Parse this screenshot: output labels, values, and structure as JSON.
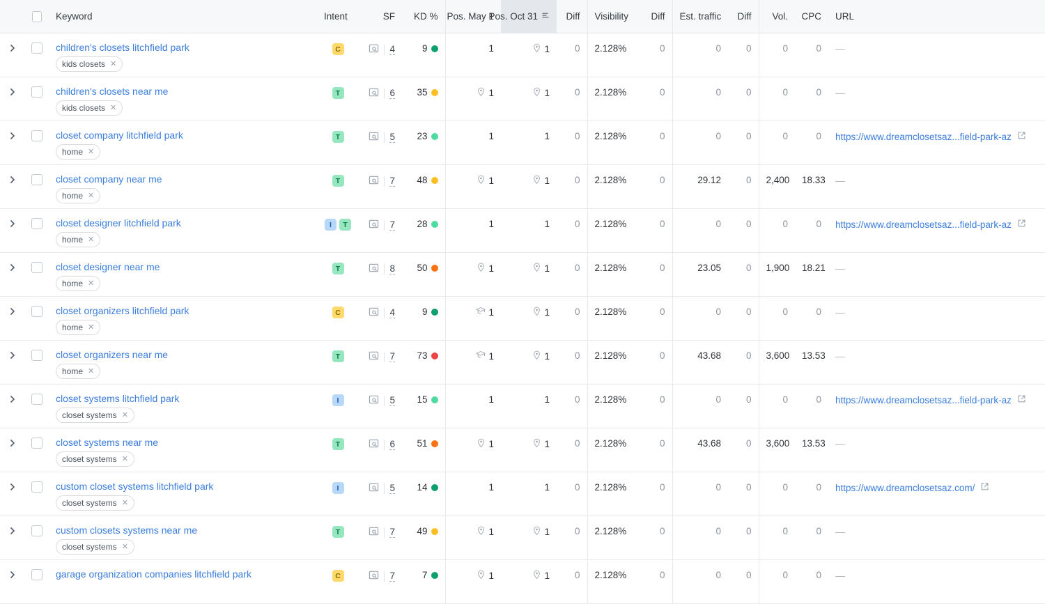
{
  "table": {
    "columns": [
      {
        "key": "expand",
        "label": "",
        "align": "left"
      },
      {
        "key": "check",
        "label": "",
        "align": "left"
      },
      {
        "key": "keyword",
        "label": "Keyword",
        "align": "left"
      },
      {
        "key": "intent",
        "label": "Intent",
        "align": "left"
      },
      {
        "key": "sf",
        "label": "SF",
        "align": "right"
      },
      {
        "key": "kd",
        "label": "KD %",
        "align": "right"
      },
      {
        "key": "pos_may",
        "label": "Pos. May 1",
        "align": "right"
      },
      {
        "key": "pos_oct",
        "label": "Pos. Oct 31",
        "align": "right",
        "sorted": true,
        "sort_icon": "sort-icon"
      },
      {
        "key": "diff1",
        "label": "Diff",
        "align": "right"
      },
      {
        "key": "vis",
        "label": "Visibility",
        "align": "left"
      },
      {
        "key": "diff2",
        "label": "Diff",
        "align": "right"
      },
      {
        "key": "traffic",
        "label": "Est. traffic",
        "align": "left"
      },
      {
        "key": "diff3",
        "label": "Diff",
        "align": "right"
      },
      {
        "key": "vol",
        "label": "Vol.",
        "align": "right"
      },
      {
        "key": "cpc",
        "label": "CPC",
        "align": "right"
      },
      {
        "key": "url",
        "label": "URL",
        "align": "left"
      }
    ],
    "header_checkbox": {
      "name": "select-all-checkbox",
      "checked": false
    },
    "kd_colors": {
      "easy": "#0e9f6e",
      "light_green": "#4ddba0",
      "yellow": "#fbbf24",
      "orange": "#f97316",
      "red": "#ef4444"
    },
    "rows": [
      {
        "keyword": "children's closets litchfield park",
        "tag": "kids closets",
        "intent": [
          "C"
        ],
        "sf": "4",
        "kd": "9",
        "kd_color": "easy",
        "pos_may": "1",
        "pos_may_icon": "",
        "pos_oct": "1",
        "pos_oct_icon": "map-pin-icon",
        "diff1": "0",
        "vis": "2.128%",
        "diff2": "0",
        "traffic": "0",
        "diff3": "0",
        "vol": "0",
        "cpc": "0",
        "url": ""
      },
      {
        "keyword": "children's closets near me",
        "tag": "kids closets",
        "intent": [
          "T"
        ],
        "sf": "6",
        "kd": "35",
        "kd_color": "yellow",
        "pos_may": "1",
        "pos_may_icon": "map-pin-icon",
        "pos_oct": "1",
        "pos_oct_icon": "map-pin-icon",
        "diff1": "0",
        "vis": "2.128%",
        "diff2": "0",
        "traffic": "0",
        "diff3": "0",
        "vol": "0",
        "cpc": "0",
        "url": ""
      },
      {
        "keyword": "closet company litchfield park",
        "tag": "home",
        "intent": [
          "T"
        ],
        "sf": "5",
        "kd": "23",
        "kd_color": "light_green",
        "pos_may": "1",
        "pos_may_icon": "",
        "pos_oct": "1",
        "pos_oct_icon": "",
        "diff1": "0",
        "vis": "2.128%",
        "diff2": "0",
        "traffic": "0",
        "diff3": "0",
        "vol": "0",
        "cpc": "0",
        "url": "https://www.dreamclosetsaz...field-park-az"
      },
      {
        "keyword": "closet company near me",
        "tag": "home",
        "intent": [
          "T"
        ],
        "sf": "7",
        "kd": "48",
        "kd_color": "yellow",
        "pos_may": "1",
        "pos_may_icon": "map-pin-icon",
        "pos_oct": "1",
        "pos_oct_icon": "map-pin-icon",
        "diff1": "0",
        "vis": "2.128%",
        "diff2": "0",
        "traffic": "29.12",
        "diff3": "0",
        "vol": "2,400",
        "cpc": "18.33",
        "url": ""
      },
      {
        "keyword": "closet designer litchfield park",
        "tag": "home",
        "intent": [
          "I",
          "T"
        ],
        "sf": "7",
        "kd": "28",
        "kd_color": "light_green",
        "pos_may": "1",
        "pos_may_icon": "",
        "pos_oct": "1",
        "pos_oct_icon": "",
        "diff1": "0",
        "vis": "2.128%",
        "diff2": "0",
        "traffic": "0",
        "diff3": "0",
        "vol": "0",
        "cpc": "0",
        "url": "https://www.dreamclosetsaz...field-park-az"
      },
      {
        "keyword": "closet designer near me",
        "tag": "home",
        "intent": [
          "T"
        ],
        "sf": "8",
        "kd": "50",
        "kd_color": "orange",
        "pos_may": "1",
        "pos_may_icon": "map-pin-icon",
        "pos_oct": "1",
        "pos_oct_icon": "map-pin-icon",
        "diff1": "0",
        "vis": "2.128%",
        "diff2": "0",
        "traffic": "23.05",
        "diff3": "0",
        "vol": "1,900",
        "cpc": "18.21",
        "url": ""
      },
      {
        "keyword": "closet organizers litchfield park",
        "tag": "home",
        "intent": [
          "C"
        ],
        "sf": "4",
        "kd": "9",
        "kd_color": "easy",
        "pos_may": "1",
        "pos_may_icon": "knowledge-panel-icon",
        "pos_oct": "1",
        "pos_oct_icon": "map-pin-icon",
        "diff1": "0",
        "vis": "2.128%",
        "diff2": "0",
        "traffic": "0",
        "diff3": "0",
        "vol": "0",
        "cpc": "0",
        "url": ""
      },
      {
        "keyword": "closet organizers near me",
        "tag": "home",
        "intent": [
          "T"
        ],
        "sf": "7",
        "kd": "73",
        "kd_color": "red",
        "pos_may": "1",
        "pos_may_icon": "knowledge-panel-icon",
        "pos_oct": "1",
        "pos_oct_icon": "map-pin-icon",
        "diff1": "0",
        "vis": "2.128%",
        "diff2": "0",
        "traffic": "43.68",
        "diff3": "0",
        "vol": "3,600",
        "cpc": "13.53",
        "url": ""
      },
      {
        "keyword": "closet systems litchfield park",
        "tag": "closet systems",
        "intent": [
          "I"
        ],
        "sf": "5",
        "kd": "15",
        "kd_color": "light_green",
        "pos_may": "1",
        "pos_may_icon": "",
        "pos_oct": "1",
        "pos_oct_icon": "",
        "diff1": "0",
        "vis": "2.128%",
        "diff2": "0",
        "traffic": "0",
        "diff3": "0",
        "vol": "0",
        "cpc": "0",
        "url": "https://www.dreamclosetsaz...field-park-az"
      },
      {
        "keyword": "closet systems near me",
        "tag": "closet systems",
        "intent": [
          "T"
        ],
        "sf": "6",
        "kd": "51",
        "kd_color": "orange",
        "pos_may": "1",
        "pos_may_icon": "map-pin-icon",
        "pos_oct": "1",
        "pos_oct_icon": "map-pin-icon",
        "diff1": "0",
        "vis": "2.128%",
        "diff2": "0",
        "traffic": "43.68",
        "diff3": "0",
        "vol": "3,600",
        "cpc": "13.53",
        "url": ""
      },
      {
        "keyword": "custom closet systems litchfield park",
        "tag": "closet systems",
        "intent": [
          "I"
        ],
        "sf": "5",
        "kd": "14",
        "kd_color": "easy",
        "pos_may": "1",
        "pos_may_icon": "",
        "pos_oct": "1",
        "pos_oct_icon": "",
        "diff1": "0",
        "vis": "2.128%",
        "diff2": "0",
        "traffic": "0",
        "diff3": "0",
        "vol": "0",
        "cpc": "0",
        "url": "https://www.dreamclosetsaz.com/"
      },
      {
        "keyword": "custom closets systems near me",
        "tag": "closet systems",
        "intent": [
          "T"
        ],
        "sf": "7",
        "kd": "49",
        "kd_color": "yellow",
        "pos_may": "1",
        "pos_may_icon": "map-pin-icon",
        "pos_oct": "1",
        "pos_oct_icon": "map-pin-icon",
        "diff1": "0",
        "vis": "2.128%",
        "diff2": "0",
        "traffic": "0",
        "diff3": "0",
        "vol": "0",
        "cpc": "0",
        "url": ""
      },
      {
        "keyword": "garage organization companies litchfield park",
        "tag": "",
        "intent": [
          "C"
        ],
        "sf": "7",
        "kd": "7",
        "kd_color": "easy",
        "pos_may": "1",
        "pos_may_icon": "map-pin-icon",
        "pos_oct": "1",
        "pos_oct_icon": "map-pin-icon",
        "diff1": "0",
        "vis": "2.128%",
        "diff2": "0",
        "traffic": "0",
        "diff3": "0",
        "vol": "0",
        "cpc": "0",
        "url": ""
      }
    ]
  },
  "icons": {
    "expand": "chevron-right-icon",
    "sf": "serp-features-icon",
    "external": "external-link-icon",
    "empty_url": "—"
  }
}
